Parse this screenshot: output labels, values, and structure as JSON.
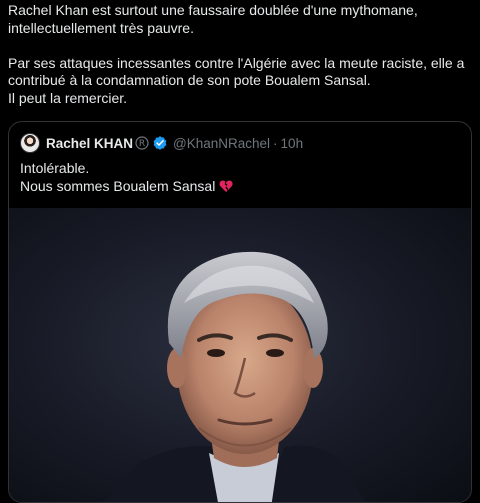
{
  "tweet": {
    "line1": "Rachel Khan est surtout une faussaire doublée d'une mythomane,",
    "line2": "intellectuellement très pauvre.",
    "line3": "Par ses attaques incessantes contre l'Algérie avec la meute raciste, elle a",
    "line4": "contribué à  la condamnation de son pote Boualem Sansal.",
    "line5": "Il peut la remercier."
  },
  "quoted": {
    "author_name": "Rachel KHAN",
    "handle": "@KhanNRachel",
    "separator": "·",
    "time": "10h",
    "text_line1": "Intolérable.",
    "text_line2": "Nous sommes Boualem Sansal",
    "emoji": "broken-heart-icon",
    "verified_color": "#1d9bf0",
    "emoji_color": "#e0245e"
  }
}
